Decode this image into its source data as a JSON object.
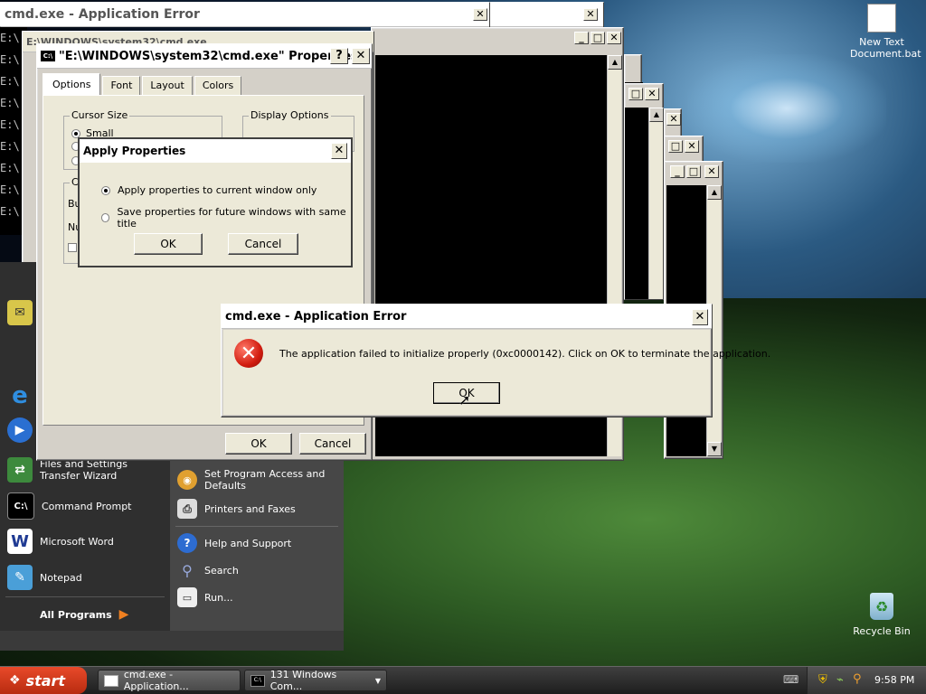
{
  "desktop": {
    "icons": [
      {
        "label_line1": "New Text",
        "label_line2": "Document.bat"
      },
      {
        "label_line1": "Recycle Bin",
        "label_line2": ""
      }
    ]
  },
  "back_window": {
    "title": "cmd.exe - Application Error",
    "close": "✕"
  },
  "cmd_window": {
    "title": "E:\\WINDOWS\\system32\\cmd.exe",
    "prompt_lines": [
      "E:\\",
      "E:\\",
      "E:\\",
      "E:\\",
      "E:\\",
      "E:\\",
      "E:\\",
      "E:\\",
      "E:\\",
      "E:\\"
    ]
  },
  "properties": {
    "title": "\"E:\\WINDOWS\\system32\\cmd.exe\" Properties",
    "help": "?",
    "close": "✕",
    "tabs": [
      "Options",
      "Font",
      "Layout",
      "Colors"
    ],
    "cursor_size_label": "Cursor Size",
    "cursor_small": "Small",
    "display_options_label": "Display Options",
    "group2_label": "Co",
    "buf_label": "Bu",
    "num_label": "Nu",
    "ok": "OK",
    "cancel": "Cancel"
  },
  "apply_properties": {
    "title": "Apply Properties",
    "close": "✕",
    "option1": "Apply properties to current window only",
    "option2": "Save properties for future windows with same title",
    "ok": "OK",
    "cancel": "Cancel"
  },
  "error_dialog": {
    "title": "cmd.exe - Application Error",
    "close": "✕",
    "message": "The application failed to initialize properly (0xc0000142). Click on OK to terminate the application.",
    "ok": "OK"
  },
  "start_menu": {
    "left_items": [
      {
        "label": "Files and Settings Transfer Wizard",
        "icon": "transfer-wizard-icon"
      },
      {
        "label": "Command Prompt",
        "icon": "cmd-icon"
      },
      {
        "label": "Microsoft Word",
        "icon": "word-icon"
      },
      {
        "label": "Notepad",
        "icon": "notepad-icon"
      }
    ],
    "all_programs": "All Programs",
    "right_items": [
      {
        "label": "Set Program Access and Defaults",
        "icon": "program-access-icon"
      },
      {
        "label": "Printers and Faxes",
        "icon": "printer-icon"
      },
      {
        "label": "Help and Support",
        "icon": "help-icon"
      },
      {
        "label": "Search",
        "icon": "search-icon"
      },
      {
        "label": "Run...",
        "icon": "run-icon"
      }
    ]
  },
  "taskbar": {
    "start": "start",
    "tasks": [
      "cmd.exe - Application...",
      "131 Windows Com..."
    ],
    "clock": "9:58 PM"
  }
}
